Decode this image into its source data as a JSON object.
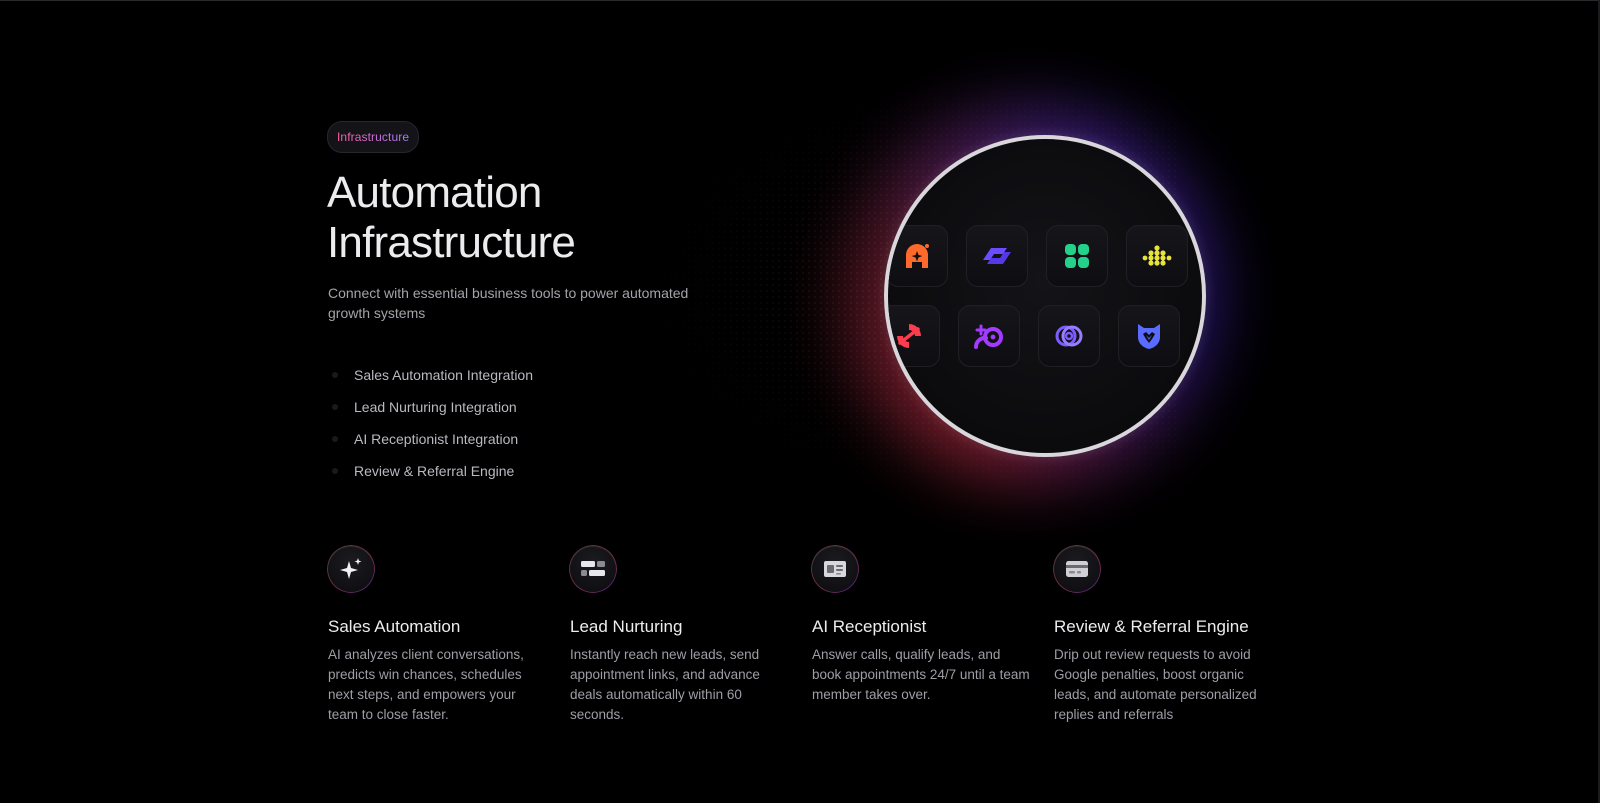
{
  "hero": {
    "badge": "Infrastructure",
    "title": "Automation Infrastructure",
    "subtitle": "Connect with essential business tools to power automated growth systems",
    "features": [
      "Sales Automation Integration",
      "Lead Nurturing Integration",
      "AI Receptionist Integration",
      "Review & Referral Engine"
    ]
  },
  "integrations": {
    "tiles": [
      {
        "icon": "orange-a-logo-icon",
        "color": "#ff6a2c"
      },
      {
        "icon": "purple-arrows-logo-icon",
        "color": "#6b4cff"
      },
      {
        "icon": "green-clover-logo-icon",
        "color": "#23d18b"
      },
      {
        "icon": "yellow-dots-logo-icon",
        "color": "#e7e33a"
      },
      {
        "icon": "red-sync-logo-icon",
        "color": "#ff3b4e"
      },
      {
        "icon": "purple-plus-logo-icon",
        "color": "#a23bff"
      },
      {
        "icon": "violet-loop-logo-icon",
        "color": "#7b5cff"
      },
      {
        "icon": "blue-shield-logo-icon",
        "color": "#5a6bff"
      }
    ]
  },
  "cards": [
    {
      "icon": "sparkle-icon",
      "title": "Sales Automation",
      "description": "AI analyzes client conversations, predicts win chances, schedules next steps, and empowers your team to close faster."
    },
    {
      "icon": "sliders-icon",
      "title": "Lead Nurturing",
      "description": "Instantly reach new leads, send appointment links, and advance deals automatically within 60 seconds."
    },
    {
      "icon": "id-card-icon",
      "title": "AI Receptionist",
      "description": "Answer calls, qualify leads, and book appointments 24/7 until a team member takes over."
    },
    {
      "icon": "card-icon",
      "title": "Review & Referral Engine",
      "description": "Drip out review requests to avoid Google penalties, boost organic leads, and automate personalized replies and referrals"
    }
  ],
  "colors": {
    "background": "#000000",
    "accent_pink": "#ff5fa8",
    "accent_purple": "#a27bff",
    "ring": "#d9d6dc"
  }
}
